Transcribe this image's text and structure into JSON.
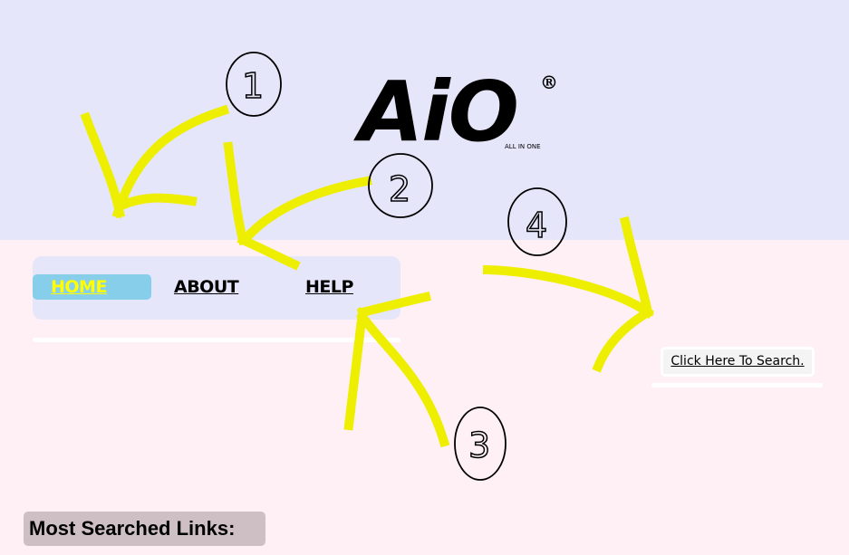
{
  "header": {
    "logo": "AiO",
    "registered": "®",
    "tagline": "ALL IN ONE",
    "background": "#e6e6fa"
  },
  "nav": {
    "items": [
      {
        "label": "HOME",
        "active": true
      },
      {
        "label": "ABOUT",
        "active": false
      },
      {
        "label": "HELP",
        "active": false
      }
    ],
    "active_bg": "#87ceeb",
    "active_color": "#ffff00"
  },
  "search": {
    "label": "Click Here To Search."
  },
  "section": {
    "title": "Most Searched Links:"
  },
  "annotations": {
    "labels": [
      "1",
      "2",
      "3",
      "4"
    ],
    "arrow_color": "#ffff00"
  },
  "page_background": "#fff0f5"
}
